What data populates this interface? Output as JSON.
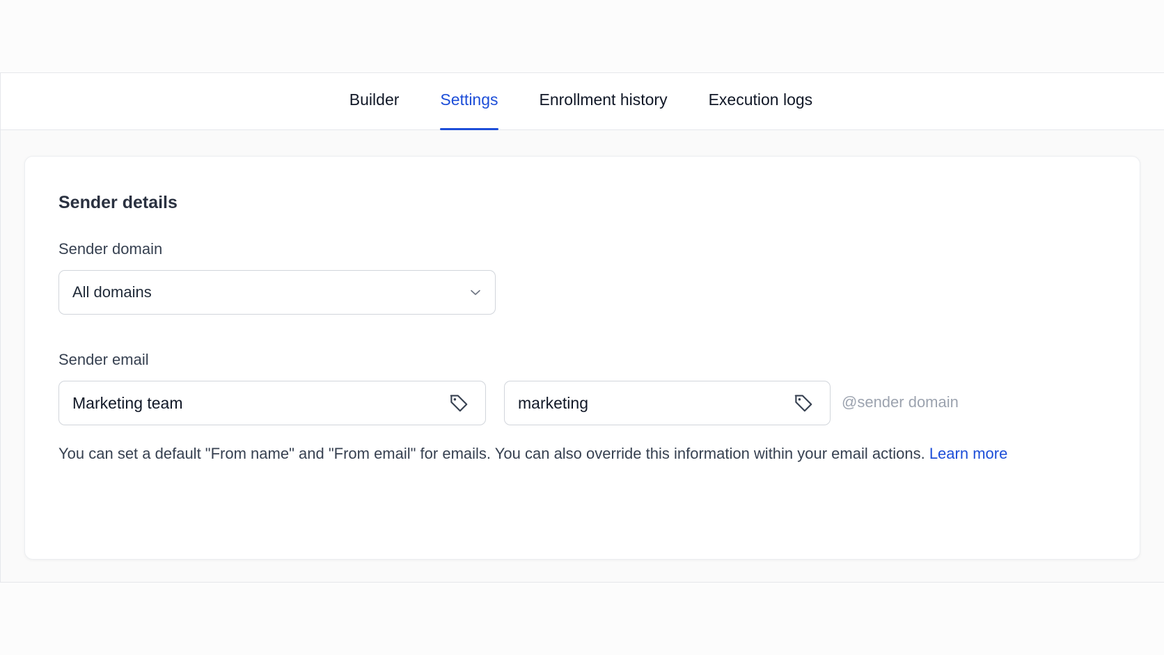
{
  "tabs": [
    {
      "label": "Builder",
      "active": false
    },
    {
      "label": "Settings",
      "active": true
    },
    {
      "label": "Enrollment history",
      "active": false
    },
    {
      "label": "Execution logs",
      "active": false
    }
  ],
  "sender_details": {
    "title": "Sender details",
    "domain": {
      "label": "Sender domain",
      "selected": "All domains",
      "icon": "chevron-down-icon"
    },
    "email": {
      "label": "Sender email",
      "from_name": "Marketing team",
      "from_local_part": "marketing",
      "suffix": "@sender domain",
      "icon": "tag-icon"
    },
    "helper_text": "You can set a default \"From name\" and \"From email\" for emails. You can also override this information within your email actions.",
    "learn_more": "Learn more"
  },
  "colors": {
    "accent": "#1d4ed8",
    "text": "#1f2937",
    "muted": "#9ca3af",
    "border": "#d1d5db"
  }
}
